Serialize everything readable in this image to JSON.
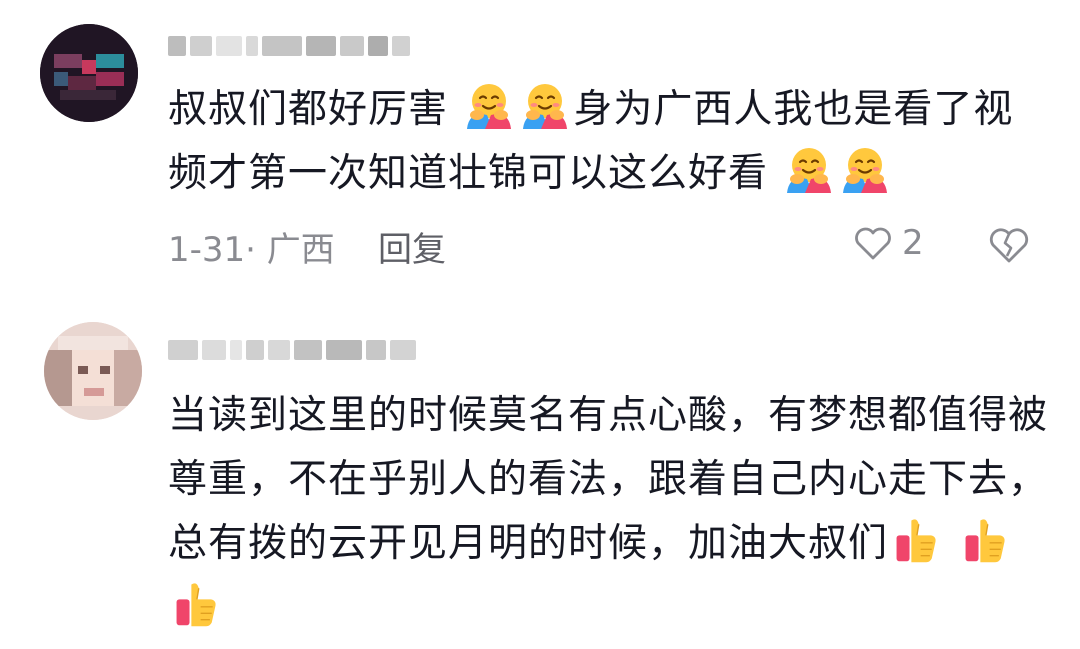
{
  "comments": [
    {
      "text_parts": [
        "叔叔们都好厉害",
        "身为广西人我也是看了视频才第一次知道壮锦可以这么好看"
      ],
      "emojis": [
        "hugging-face-emoji",
        "hugging-face-emoji",
        "hugging-face-emoji",
        "hugging-face-emoji"
      ],
      "date_location": "1-31· 广西",
      "reply_label": "回复",
      "like_count": "2"
    },
    {
      "text": "当读到这里的时候莫名有点心酸，有梦想都值得被尊重，不在乎别人的看法，跟着自己内心走下去，总有拨的云开见月明的时候，加油大叔们",
      "emojis": [
        "thumbs-up-emoji",
        "thumbs-up-emoji",
        "thumbs-up-emoji"
      ]
    }
  ],
  "colors": {
    "text": "#161823",
    "meta": "#8a8b91",
    "reply": "#5e5f66"
  }
}
